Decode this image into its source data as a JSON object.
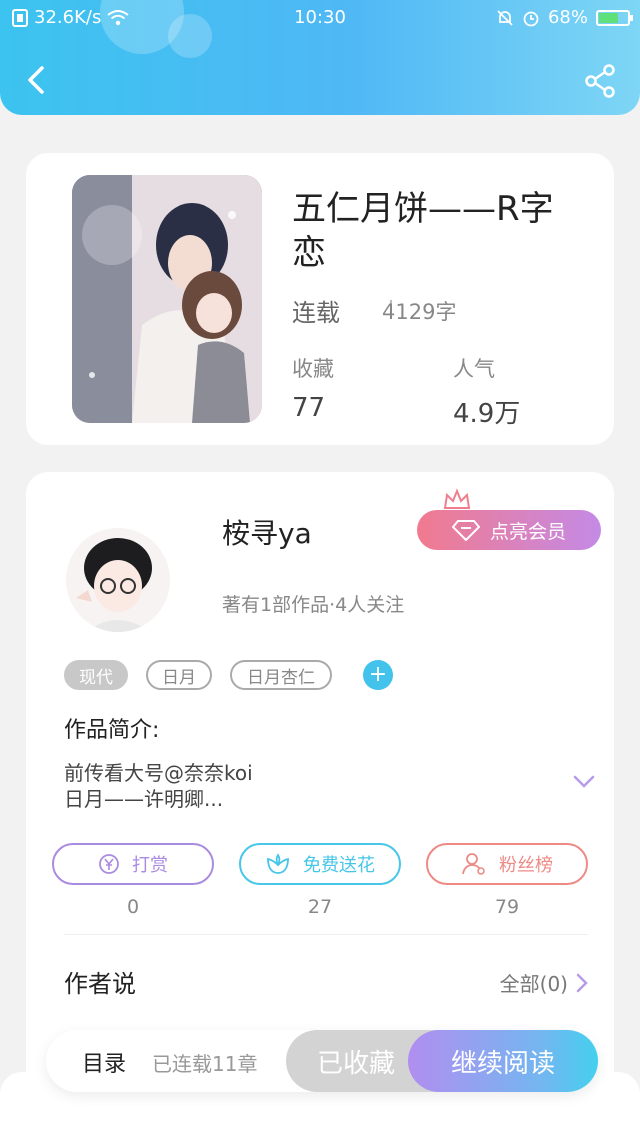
{
  "status_bar": {
    "network_speed": "32.6K/s",
    "time": "10:30",
    "battery": "68%",
    "battery_level": 0.68
  },
  "book": {
    "title": "五仁月饼——R字恋",
    "status": "连载",
    "word_count": "4129字",
    "stats": [
      {
        "label": "收藏",
        "value": "77"
      },
      {
        "label": "人气",
        "value": "4.9万"
      }
    ]
  },
  "author": {
    "name": "桉寻ya",
    "meta": "著有1部作品·4人关注",
    "vip_label": "点亮会员",
    "tags": [
      "现代",
      "日月",
      "日月杏仁"
    ],
    "intro_title": "作品简介:",
    "intro_lines": [
      "前传看大号@奈奈koi",
      "日月——许明卿..."
    ],
    "actions": [
      {
        "label": "打赏",
        "count": "0",
        "color": "#a98be0"
      },
      {
        "label": "免费送花",
        "count": "27",
        "color": "#46c6e8"
      },
      {
        "label": "粉丝榜",
        "count": "79",
        "color": "#ee8a86"
      }
    ],
    "author_says_title": "作者说",
    "all_link": "全部(0)"
  },
  "bottom_bar": {
    "toc_label": "目录",
    "chapters_label": "已连载11章",
    "collected_label": "已收藏",
    "read_label": "继续阅读"
  }
}
